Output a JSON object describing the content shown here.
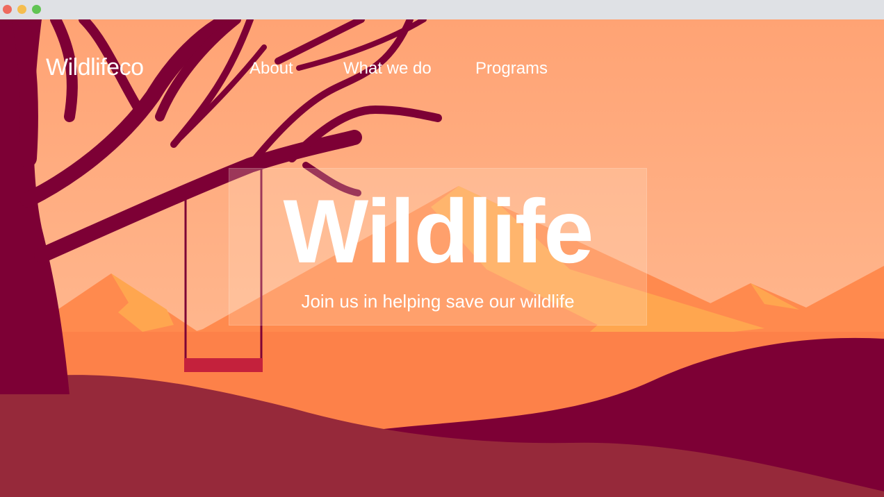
{
  "window": {
    "controls": [
      "close",
      "minimize",
      "maximize"
    ]
  },
  "colors": {
    "sky_top": "#ffa374",
    "sky_bottom": "#ffbd92",
    "mountain": "#ff8a4e",
    "mountain_highlight": "#ffa64f",
    "tree": "#7d0035",
    "hill_front": "#96293a",
    "swing_seat": "#c4213c"
  },
  "nav": {
    "logo": "Wildlifeco",
    "links": [
      "About",
      "What we do",
      "Programs"
    ]
  },
  "hero": {
    "title": "Wildlife",
    "subtitle": "Join us in helping save our wildlife"
  }
}
